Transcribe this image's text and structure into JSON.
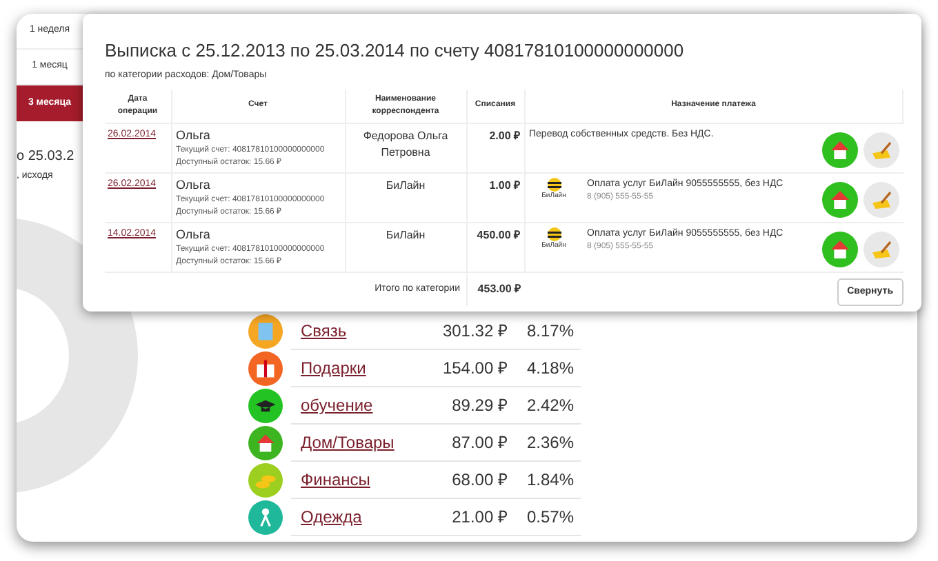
{
  "period_tabs": [
    {
      "label": "1 неделя",
      "selected": false
    },
    {
      "label": "1 месяц",
      "selected": false
    },
    {
      "label": "3 месяца",
      "selected": true
    }
  ],
  "background_text": {
    "line_1": "о 25.03.2",
    "line_2": ", исходя"
  },
  "categories": [
    {
      "kind": "phone",
      "color": "#f5a623",
      "name": "Связь",
      "amount": "301.32 ₽",
      "percent": "8.17%"
    },
    {
      "kind": "gift",
      "color": "#f26522",
      "name": "Подарки",
      "amount": "154.00 ₽",
      "percent": "4.18%"
    },
    {
      "kind": "cap",
      "color": "#22c322",
      "name": "обучение",
      "amount": "89.29 ₽",
      "percent": "2.42%"
    },
    {
      "kind": "house",
      "color": "#3cb521",
      "name": "Дом/Товары",
      "amount": "87.00 ₽",
      "percent": "2.36%"
    },
    {
      "kind": "coins",
      "color": "#9ccf1f",
      "name": "Финансы",
      "amount": "68.00 ₽",
      "percent": "1.84%"
    },
    {
      "kind": "person",
      "color": "#1fb89a",
      "name": "Одежда",
      "amount": "21.00 ₽",
      "percent": "0.57%"
    }
  ],
  "statement": {
    "title": "Выписка с 25.12.2013 по 25.03.2014 по счету 40817810100000000000",
    "subtitle": "по категории расходов: Дом/Товары",
    "columns": [
      "Дата операции",
      "Счет",
      "Наименование корреспондента",
      "Списания",
      "Назначение платежа"
    ],
    "rows": [
      {
        "date": "26.02.2014",
        "account_name": "Ольга",
        "account_number": "Текущий счет: 40817810100000000000",
        "balance": "Доступный остаток: 15.66 ₽",
        "correspondent": "Федорова Ольга Петровна",
        "amount": "2.00 ₽",
        "kind": "transfer",
        "purpose": "Перевод собственных средств. Без НДС."
      },
      {
        "date": "26.02.2014",
        "account_name": "Ольга",
        "account_number": "Текущий счет: 40817810100000000000",
        "balance": "Доступный остаток: 15.66 ₽",
        "correspondent": "БиЛайн",
        "amount": "1.00 ₽",
        "kind": "operator",
        "logo_text": "БиЛайн",
        "purpose": "Оплата услуг БиЛайн 9055555555, без НДС",
        "purpose_detail": "8 (905) 555-55-55"
      },
      {
        "date": "14.02.2014",
        "account_name": "Ольга",
        "account_number": "Текущий счет: 40817810100000000000",
        "balance": "Доступный остаток: 15.66 ₽",
        "correspondent": "БиЛайн",
        "amount": "450.00 ₽",
        "kind": "operator",
        "logo_text": "БиЛайн",
        "purpose": "Оплата услуг БиЛайн 9055555555, без НДС",
        "purpose_detail": "8 (905) 555-55-55"
      }
    ],
    "total_label": "Итого по категории",
    "total": "453.00 ₽",
    "collapse_button": "Свернуть"
  }
}
